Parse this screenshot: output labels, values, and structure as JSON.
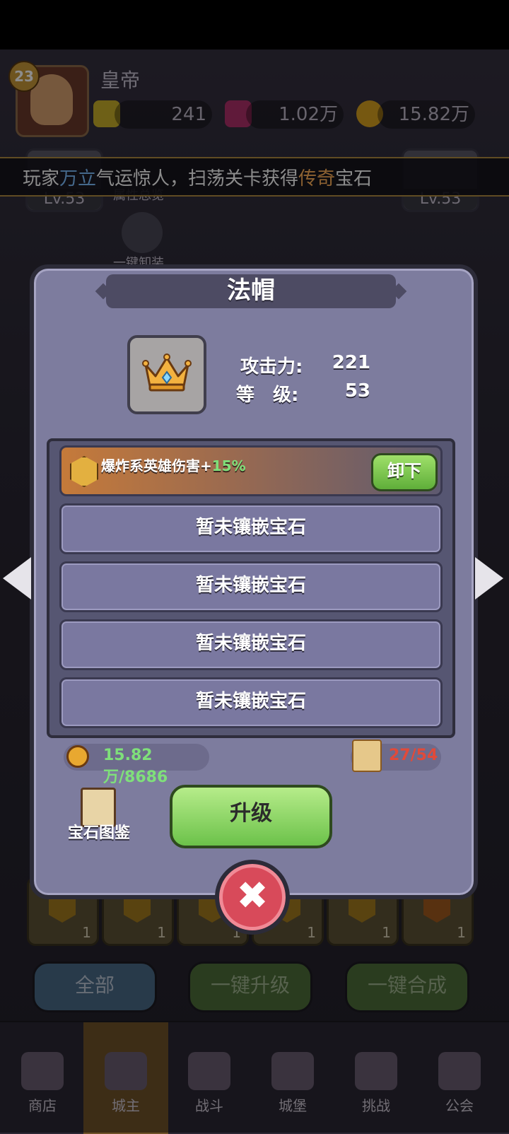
{
  "player": {
    "level": "23",
    "name": "皇帝"
  },
  "resources": {
    "energy": "241",
    "gems": "1.02万",
    "gold": "15.82万"
  },
  "ticker": {
    "prefix": "玩家",
    "player": "万立",
    "middle": "气运惊人，扫荡关卡获得",
    "rarity": "传奇",
    "suffix": "宝石"
  },
  "background": {
    "left_slot_level": "Lv.53",
    "right_slot_level": "Lv.53",
    "attr_overview": "属性总览",
    "unequip_all": "一键卸装",
    "gem_counts": [
      "1",
      "1",
      "1",
      "1",
      "1",
      "1"
    ],
    "buttons": {
      "all": "全部",
      "upgrade_all": "一键升级",
      "merge_all": "一键合成"
    }
  },
  "nav": {
    "items": [
      "商店",
      "城主",
      "战斗",
      "城堡",
      "挑战",
      "公会"
    ]
  },
  "modal": {
    "title": "法帽",
    "icon": "crown-icon",
    "stats": [
      {
        "label": "攻击力:",
        "value": "221"
      },
      {
        "label": "等　级:",
        "value": "53"
      }
    ],
    "equipped_gem": {
      "effect": "爆炸系英雄伤害+",
      "percent": "15%",
      "unequip_label": "卸下"
    },
    "empty_slot_label": "暂未镶嵌宝石",
    "cost": "15.82万/8686",
    "scroll": "27/54",
    "codex_label": "宝石图鉴",
    "upgrade_label": "升级",
    "close_symbol": "✖"
  },
  "colors": {
    "accent_green": "#7fe07a",
    "warning_red": "#e04a3a",
    "ticker_name": "#7fc0ff",
    "ticker_rarity": "#ffb15a"
  }
}
